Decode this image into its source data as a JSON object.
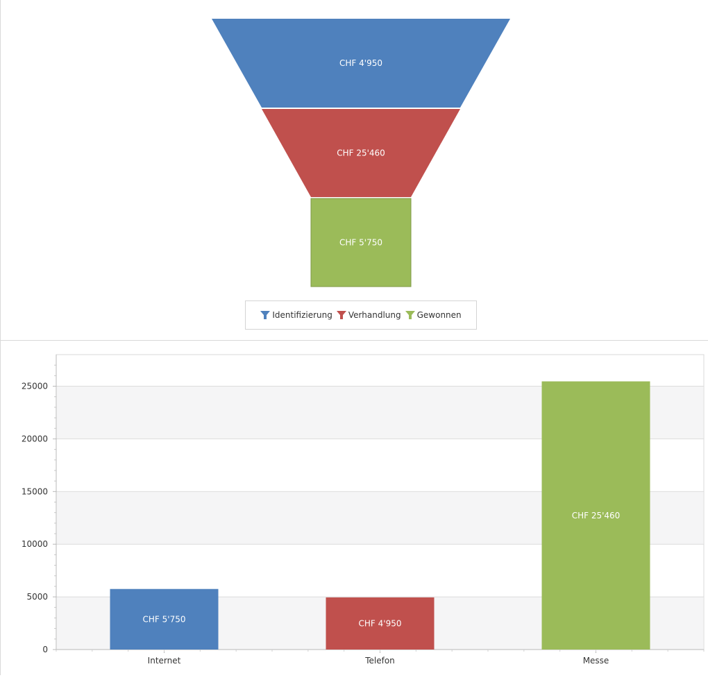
{
  "chart_data": [
    {
      "type": "funnel",
      "stages": [
        {
          "name": "Identifizierung",
          "value": 4950,
          "label": "CHF 4'950",
          "color": "#4f81bd"
        },
        {
          "name": "Verhandlung",
          "value": 25460,
          "label": "CHF 25'460",
          "color": "#c0504d"
        },
        {
          "name": "Gewonnen",
          "value": 5750,
          "label": "CHF 5'750",
          "color": "#9bbb59"
        }
      ],
      "legend": {
        "position": "bottom",
        "items": [
          "Identifizierung",
          "Verhandlung",
          "Gewonnen"
        ]
      }
    },
    {
      "type": "bar",
      "categories": [
        "Internet",
        "Telefon",
        "Messe"
      ],
      "values": [
        5750,
        4950,
        25460
      ],
      "data_labels": [
        "CHF 5'750",
        "CHF 4'950",
        "CHF 25'460"
      ],
      "colors": [
        "#4f81bd",
        "#c0504d",
        "#9bbb59"
      ],
      "yticks": [
        "0",
        "5000",
        "10000",
        "15000",
        "20000",
        "25000"
      ],
      "ylim": [
        0,
        28000
      ],
      "grid": true
    }
  ]
}
